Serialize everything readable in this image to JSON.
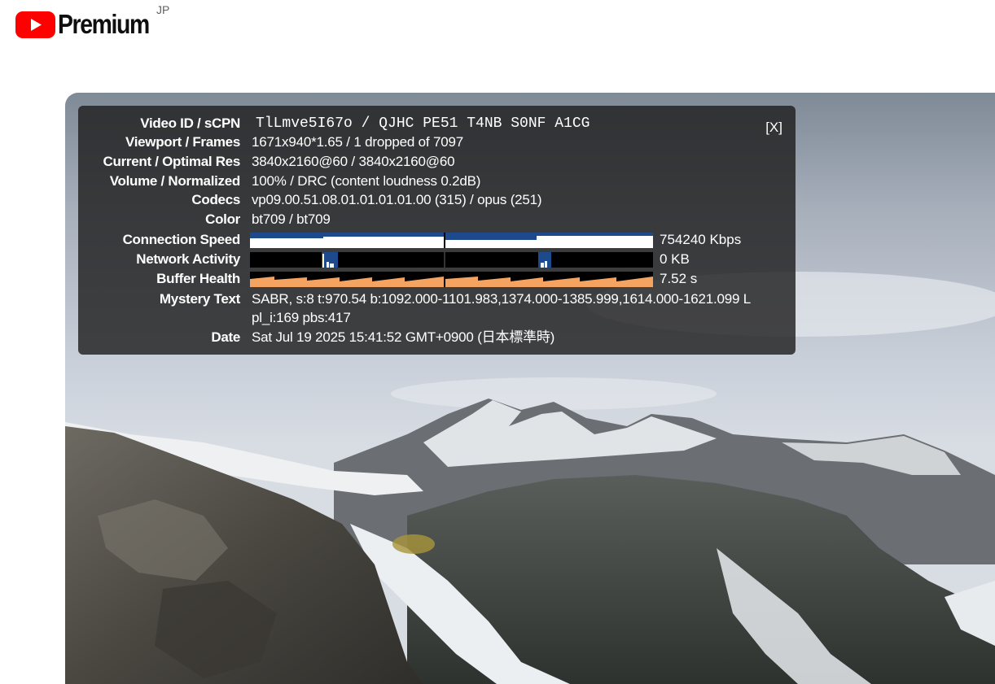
{
  "masthead": {
    "brand": "Premium",
    "region": "JP"
  },
  "stats": {
    "close_label": "[X]",
    "rows": [
      {
        "label": "Video ID / sCPN",
        "value": "TlLmve5I67o / QJHC PE51 T4NB S0NF A1CG"
      },
      {
        "label": "Viewport / Frames",
        "value": "1671x940*1.65 / 1 dropped of 7097"
      },
      {
        "label": "Current / Optimal Res",
        "value": "3840x2160@60 / 3840x2160@60"
      },
      {
        "label": "Volume / Normalized",
        "value": "100% / DRC (content loudness 0.2dB)"
      },
      {
        "label": "Codecs",
        "value": "vp09.00.51.08.01.01.01.01.00 (315) / opus (251)"
      },
      {
        "label": "Color",
        "value": "bt709 / bt709"
      }
    ],
    "connection_speed": {
      "label": "Connection Speed",
      "value": "754240 Kbps"
    },
    "network_activity": {
      "label": "Network Activity",
      "value": "0 KB"
    },
    "buffer_health": {
      "label": "Buffer Health",
      "value": "7.52 s"
    },
    "mystery_text": {
      "label": "Mystery Text",
      "line1": "SABR, s:8 t:970.54 b:1092.000-1101.983,1374.000-1385.999,1614.000-1621.099 L",
      "line2": "pl_i:169 pbs:417"
    },
    "date": {
      "label": "Date",
      "value": "Sat Jul 19 2025 15:41:52 GMT+0900 (日本標準時)"
    }
  },
  "colors": {
    "youtube_red": "#ff0000",
    "graph_blue": "#1c4a8c",
    "graph_buffer": "#f4a460",
    "graph_activity": "#2a5cae"
  }
}
